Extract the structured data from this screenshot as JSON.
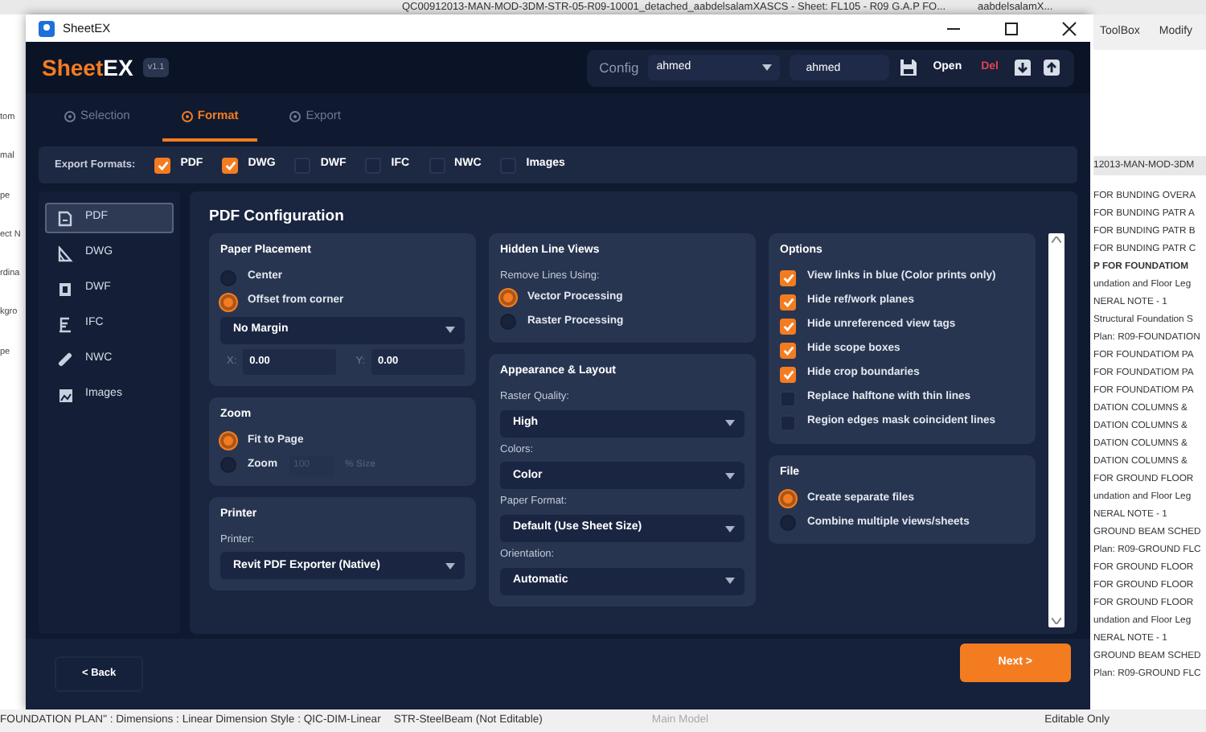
{
  "host_app": {
    "title_bar": "QC00912013-MAN-MOD-3DM-STR-05-R09-10001_detached_aabdelsalamXASCS - Sheet: FL105 - R09 G.A.P FO...",
    "user": "aabdelsalamX...",
    "ribbon_tabs": [
      "ToolBox",
      "Modify"
    ],
    "left_fragments": [
      "tom",
      "mal",
      "pe",
      "ect N",
      "rdina",
      "kgro",
      "pe"
    ],
    "browser_header": "12013-MAN-MOD-3DM",
    "browser_items": [
      {
        "text": "FOR BUNDING OVERA",
        "bold": false
      },
      {
        "text": "FOR BUNDING PATR A",
        "bold": false
      },
      {
        "text": "FOR BUNDING PATR B",
        "bold": false
      },
      {
        "text": "FOR BUNDING PATR C",
        "bold": false
      },
      {
        "text": "P FOR FOUNDATIOM",
        "bold": true
      },
      {
        "text": "undation and Floor Leg",
        "bold": false
      },
      {
        "text": "NERAL NOTE - 1",
        "bold": false
      },
      {
        "text": "Structural Foundation S",
        "bold": false
      },
      {
        "text": "Plan: R09-FOUNDATION",
        "bold": false
      },
      {
        "text": "FOR FOUNDATIOM PA",
        "bold": false
      },
      {
        "text": "FOR FOUNDATIOM PA",
        "bold": false
      },
      {
        "text": "FOR FOUNDATIOM PA",
        "bold": false
      },
      {
        "text": "DATION COLUMNS &",
        "bold": false
      },
      {
        "text": "DATION COLUMNS &",
        "bold": false
      },
      {
        "text": "DATION COLUMNS &",
        "bold": false
      },
      {
        "text": "DATION COLUMNS &",
        "bold": false
      },
      {
        "text": "FOR GROUND FLOOR",
        "bold": false
      },
      {
        "text": "undation and Floor Leg",
        "bold": false
      },
      {
        "text": "NERAL NOTE - 1",
        "bold": false
      },
      {
        "text": "GROUND BEAM SCHED",
        "bold": false
      },
      {
        "text": "Plan: R09-GROUND FLC",
        "bold": false
      },
      {
        "text": "FOR GROUND FLOOR",
        "bold": false
      },
      {
        "text": "FOR GROUND FLOOR",
        "bold": false
      },
      {
        "text": "FOR GROUND FLOOR",
        "bold": false
      },
      {
        "text": "undation and Floor Leg",
        "bold": false
      },
      {
        "text": "NERAL NOTE - 1",
        "bold": false
      },
      {
        "text": "GROUND BEAM SCHED",
        "bold": false
      },
      {
        "text": "Plan: R09-GROUND FLC",
        "bold": false
      }
    ],
    "status_bar": {
      "text": "FOUNDATION PLAN\" : Dimensions : Linear Dimension Style : QIC-DIM-Linear",
      "workset": "STR-SteelBeam (Not Editable)",
      "model": "Main Model",
      "editable_only": "Editable Only"
    }
  },
  "window": {
    "title": "SheetEX"
  },
  "brand": {
    "part_1": "Sheet",
    "part_2": "EX",
    "version": "v1.1"
  },
  "config": {
    "label": "Config",
    "selected": "ahmed",
    "name_value": "ahmed",
    "buttons": [
      {
        "label": "Open",
        "danger": false
      },
      {
        "label": "Del",
        "danger": true
      }
    ]
  },
  "tabs": [
    {
      "label": "Selection",
      "selected": false
    },
    {
      "label": "Format",
      "selected": true
    },
    {
      "label": "Export",
      "selected": false
    }
  ],
  "export_formats": {
    "label": "Export Formats:",
    "items": [
      {
        "label": "PDF",
        "checked": true
      },
      {
        "label": "DWG",
        "checked": true
      },
      {
        "label": "DWF",
        "checked": false
      },
      {
        "label": "IFC",
        "checked": false
      },
      {
        "label": "NWC",
        "checked": false
      },
      {
        "label": "Images",
        "checked": false
      }
    ]
  },
  "sidebar": [
    {
      "label": "PDF",
      "selected": true
    },
    {
      "label": "DWG",
      "selected": false
    },
    {
      "label": "DWF",
      "selected": false
    },
    {
      "label": "IFC",
      "selected": false
    },
    {
      "label": "NWC",
      "selected": false
    },
    {
      "label": "Images",
      "selected": false
    }
  ],
  "panel_title": "PDF Configuration",
  "columns": [
    [
      {
        "title": "Paper Placement",
        "rows": [
          {
            "kind": "radio",
            "label": "Center",
            "checked": false
          },
          {
            "kind": "radio",
            "label": "Offset from corner",
            "checked": true
          },
          {
            "kind": "select",
            "value": "No Margin"
          },
          {
            "kind": "xy",
            "x_label": "X:",
            "x_value": "0.00",
            "y_label": "Y:",
            "y_value": "0.00"
          }
        ]
      },
      {
        "title": "Zoom",
        "rows": [
          {
            "kind": "radio",
            "label": "Fit to Page",
            "checked": true
          },
          {
            "kind": "radio_input",
            "label": "Zoom",
            "checked": false,
            "value": "100",
            "suffix": "% Size",
            "disabled": true
          }
        ]
      },
      {
        "title": "Printer",
        "rows": [
          {
            "kind": "label",
            "text": "Printer:"
          },
          {
            "kind": "select",
            "value": "Revit PDF Exporter (Native)"
          }
        ]
      }
    ],
    [
      {
        "title": "Hidden Line Views",
        "rows": [
          {
            "kind": "label",
            "text": "Remove Lines Using:"
          },
          {
            "kind": "radio",
            "label": "Vector Processing",
            "checked": true
          },
          {
            "kind": "radio",
            "label": "Raster Processing",
            "checked": false
          }
        ]
      },
      {
        "title": "Appearance & Layout",
        "rows": [
          {
            "kind": "label",
            "text": "Raster Quality:"
          },
          {
            "kind": "select",
            "value": "High"
          },
          {
            "kind": "label",
            "text": "Colors:"
          },
          {
            "kind": "select",
            "value": "Color"
          },
          {
            "kind": "label",
            "text": "Paper Format:"
          },
          {
            "kind": "select",
            "value": "Default (Use Sheet Size)"
          },
          {
            "kind": "label",
            "text": "Orientation:"
          },
          {
            "kind": "select",
            "value": "Automatic"
          }
        ]
      }
    ],
    [
      {
        "title": "Options",
        "rows": [
          {
            "kind": "checkbox",
            "label": "View links in blue (Color prints only)",
            "checked": true
          },
          {
            "kind": "checkbox",
            "label": "Hide ref/work planes",
            "checked": true
          },
          {
            "kind": "checkbox",
            "label": "Hide unreferenced view tags",
            "checked": true
          },
          {
            "kind": "checkbox",
            "label": "Hide scope boxes",
            "checked": true
          },
          {
            "kind": "checkbox",
            "label": "Hide crop boundaries",
            "checked": true
          },
          {
            "kind": "checkbox",
            "label": "Replace halftone with thin lines",
            "checked": false
          },
          {
            "kind": "checkbox",
            "label": "Region edges mask coincident lines",
            "checked": false
          }
        ]
      },
      {
        "title": "File",
        "rows": [
          {
            "kind": "radio",
            "label": "Create separate files",
            "checked": true
          },
          {
            "kind": "radio",
            "label": "Combine multiple views/sheets",
            "checked": false
          }
        ]
      }
    ]
  ],
  "footer": {
    "back": "<  Back",
    "next": "Next  >"
  }
}
